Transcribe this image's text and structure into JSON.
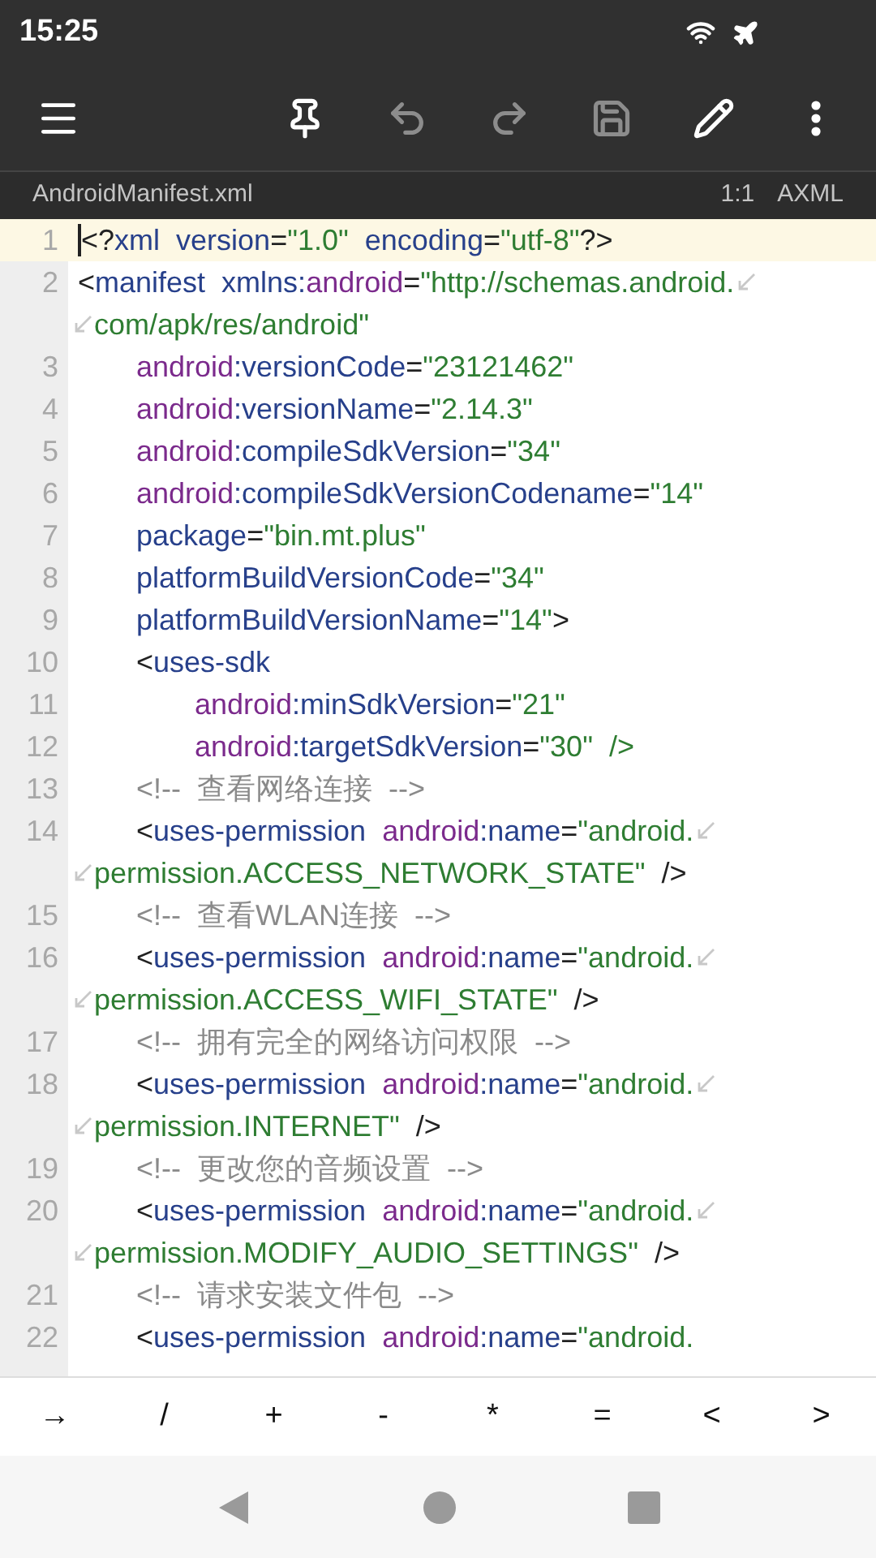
{
  "status_bar": {
    "time": "15:25"
  },
  "toolbar": [
    {
      "kind": "pin",
      "disabled": false
    },
    {
      "kind": "undo",
      "disabled": true
    },
    {
      "kind": "redo",
      "disabled": true
    },
    {
      "kind": "save",
      "disabled": true
    },
    {
      "kind": "edit",
      "disabled": false
    },
    {
      "kind": "more",
      "disabled": false
    }
  ],
  "file_bar": {
    "name": "AndroidManifest.xml",
    "position": "1:1",
    "format": "AXML"
  },
  "editor": {
    "lines": [
      {
        "number": "1",
        "selected": true,
        "segments": [
          [
            {
              "kind": "punct",
              "text": "<?"
            },
            {
              "kind": "tag",
              "text": "xml  version"
            },
            {
              "kind": "punct",
              "text": "="
            },
            {
              "kind": "value",
              "text": "\"1.0\""
            },
            {
              "kind": "tag",
              "text": "  encoding"
            },
            {
              "kind": "punct",
              "text": "="
            },
            {
              "kind": "value",
              "text": "\"utf-8\""
            },
            {
              "kind": "punct",
              "text": "?>"
            }
          ]
        ]
      },
      {
        "number": "2",
        "selected": false,
        "segments": [
          [
            {
              "kind": "punct",
              "text": "<"
            },
            {
              "kind": "tag",
              "text": "manifest  xmlns:"
            },
            {
              "kind": "ns",
              "text": "android"
            },
            {
              "kind": "punct",
              "text": "="
            },
            {
              "kind": "value",
              "text": "\"http://schemas.android."
            }
          ],
          [
            {
              "kind": "value",
              "text": "com/apk/res/android\""
            }
          ]
        ],
        "children": [
          {
            "number": "3",
            "selected": false,
            "segments": [
              [
                {
                  "kind": "ns",
                  "text": "android"
                },
                {
                  "kind": "tag",
                  "text": ":versionCode"
                },
                {
                  "kind": "punct",
                  "text": "="
                },
                {
                  "kind": "value",
                  "text": "\"23121462\""
                }
              ]
            ]
          },
          {
            "number": "4",
            "selected": false,
            "segments": [
              [
                {
                  "kind": "ns",
                  "text": "android"
                },
                {
                  "kind": "tag",
                  "text": ":versionName"
                },
                {
                  "kind": "punct",
                  "text": "="
                },
                {
                  "kind": "value",
                  "text": "\"2.14.3\""
                }
              ]
            ]
          },
          {
            "number": "5",
            "selected": false,
            "segments": [
              [
                {
                  "kind": "ns",
                  "text": "android"
                },
                {
                  "kind": "tag",
                  "text": ":compileSdkVersion"
                },
                {
                  "kind": "punct",
                  "text": "="
                },
                {
                  "kind": "value",
                  "text": "\"34\""
                }
              ]
            ]
          },
          {
            "number": "6",
            "selected": false,
            "segments": [
              [
                {
                  "kind": "ns",
                  "text": "android"
                },
                {
                  "kind": "tag",
                  "text": ":compileSdkVersionCodename"
                },
                {
                  "kind": "punct",
                  "text": "="
                },
                {
                  "kind": "value",
                  "text": "\"14\""
                }
              ]
            ]
          },
          {
            "number": "7",
            "selected": false,
            "segments": [
              [
                {
                  "kind": "tag",
                  "text": "package"
                },
                {
                  "kind": "punct",
                  "text": "="
                },
                {
                  "kind": "value",
                  "text": "\"bin.mt.plus\""
                }
              ]
            ]
          },
          {
            "number": "8",
            "selected": false,
            "segments": [
              [
                {
                  "kind": "tag",
                  "text": "platformBuildVersionCode"
                },
                {
                  "kind": "punct",
                  "text": "="
                },
                {
                  "kind": "value",
                  "text": "\"34\""
                }
              ]
            ]
          },
          {
            "number": "9",
            "selected": false,
            "segments": [
              [
                {
                  "kind": "tag",
                  "text": "platformBuildVersionName"
                },
                {
                  "kind": "punct",
                  "text": "="
                },
                {
                  "kind": "value",
                  "text": "\"14\""
                },
                {
                  "kind": "punct",
                  "text": ">"
                }
              ]
            ]
          },
          {
            "number": "10",
            "selected": false,
            "segments": [
              [
                {
                  "kind": "punct",
                  "text": "<"
                },
                {
                  "kind": "tag",
                  "text": "uses-sdk"
                }
              ]
            ],
            "children": [
              {
                "number": "11",
                "selected": false,
                "segments": [
                  [
                    {
                      "kind": "ns",
                      "text": "android"
                    },
                    {
                      "kind": "tag",
                      "text": ":minSdkVersion"
                    },
                    {
                      "kind": "punct",
                      "text": "="
                    },
                    {
                      "kind": "value",
                      "text": "\"21\""
                    }
                  ]
                ]
              },
              {
                "number": "12",
                "selected": false,
                "segments": [
                  [
                    {
                      "kind": "ns",
                      "text": "android"
                    },
                    {
                      "kind": "tag",
                      "text": ":targetSdkVersion"
                    },
                    {
                      "kind": "punct",
                      "text": "="
                    },
                    {
                      "kind": "value",
                      "text": "\"30\"  />"
                    }
                  ]
                ]
              }
            ]
          },
          {
            "number": "13",
            "selected": false,
            "segments": [
              [
                {
                  "kind": "comment",
                  "text": "<!--  查看网络连接  -->"
                }
              ]
            ]
          },
          {
            "number": "14",
            "selected": false,
            "segments": [
              [
                {
                  "kind": "punct",
                  "text": "<"
                },
                {
                  "kind": "tag",
                  "text": "uses-permission  "
                },
                {
                  "kind": "ns",
                  "text": "android"
                },
                {
                  "kind": "tag",
                  "text": ":name"
                },
                {
                  "kind": "punct",
                  "text": "="
                },
                {
                  "kind": "value",
                  "text": "\"android."
                }
              ],
              [
                {
                  "kind": "value",
                  "text": "permission.ACCESS_NETWORK_STATE\""
                },
                {
                  "kind": "punct",
                  "text": "  />"
                }
              ]
            ]
          },
          {
            "number": "15",
            "selected": false,
            "segments": [
              [
                {
                  "kind": "comment",
                  "text": "<!--  查看WLAN连接  -->"
                }
              ]
            ]
          },
          {
            "number": "16",
            "selected": false,
            "segments": [
              [
                {
                  "kind": "punct",
                  "text": "<"
                },
                {
                  "kind": "tag",
                  "text": "uses-permission  "
                },
                {
                  "kind": "ns",
                  "text": "android"
                },
                {
                  "kind": "tag",
                  "text": ":name"
                },
                {
                  "kind": "punct",
                  "text": "="
                },
                {
                  "kind": "value",
                  "text": "\"android."
                }
              ],
              [
                {
                  "kind": "value",
                  "text": "permission.ACCESS_WIFI_STATE\""
                },
                {
                  "kind": "punct",
                  "text": "  />"
                }
              ]
            ]
          },
          {
            "number": "17",
            "selected": false,
            "segments": [
              [
                {
                  "kind": "comment",
                  "text": "<!--  拥有完全的网络访问权限  -->"
                }
              ]
            ]
          },
          {
            "number": "18",
            "selected": false,
            "segments": [
              [
                {
                  "kind": "punct",
                  "text": "<"
                },
                {
                  "kind": "tag",
                  "text": "uses-permission  "
                },
                {
                  "kind": "ns",
                  "text": "android"
                },
                {
                  "kind": "tag",
                  "text": ":name"
                },
                {
                  "kind": "punct",
                  "text": "="
                },
                {
                  "kind": "value",
                  "text": "\"android."
                }
              ],
              [
                {
                  "kind": "value",
                  "text": "permission.INTERNET\""
                },
                {
                  "kind": "punct",
                  "text": "  />"
                }
              ]
            ]
          },
          {
            "number": "19",
            "selected": false,
            "segments": [
              [
                {
                  "kind": "comment",
                  "text": "<!--  更改您的音频设置  -->"
                }
              ]
            ]
          },
          {
            "number": "20",
            "selected": false,
            "segments": [
              [
                {
                  "kind": "punct",
                  "text": "<"
                },
                {
                  "kind": "tag",
                  "text": "uses-permission  "
                },
                {
                  "kind": "ns",
                  "text": "android"
                },
                {
                  "kind": "tag",
                  "text": ":name"
                },
                {
                  "kind": "punct",
                  "text": "="
                },
                {
                  "kind": "value",
                  "text": "\"android."
                }
              ],
              [
                {
                  "kind": "value",
                  "text": "permission.MODIFY_AUDIO_SETTINGS\""
                },
                {
                  "kind": "punct",
                  "text": "  />"
                }
              ]
            ]
          },
          {
            "number": "21",
            "selected": false,
            "segments": [
              [
                {
                  "kind": "comment",
                  "text": "<!--  请求安装文件包  -->"
                }
              ]
            ]
          },
          {
            "number": "22",
            "selected": false,
            "segments": [
              [
                {
                  "kind": "punct",
                  "text": "<"
                },
                {
                  "kind": "tag",
                  "text": "uses-permission  "
                },
                {
                  "kind": "ns",
                  "text": "android"
                },
                {
                  "kind": "tag",
                  "text": ":name"
                },
                {
                  "kind": "punct",
                  "text": "="
                },
                {
                  "kind": "value",
                  "text": "\"android."
                }
              ]
            ]
          }
        ]
      }
    ]
  },
  "symbol_keys": [
    "→",
    "/",
    "+",
    "-",
    "*",
    "=",
    "<",
    ">"
  ]
}
